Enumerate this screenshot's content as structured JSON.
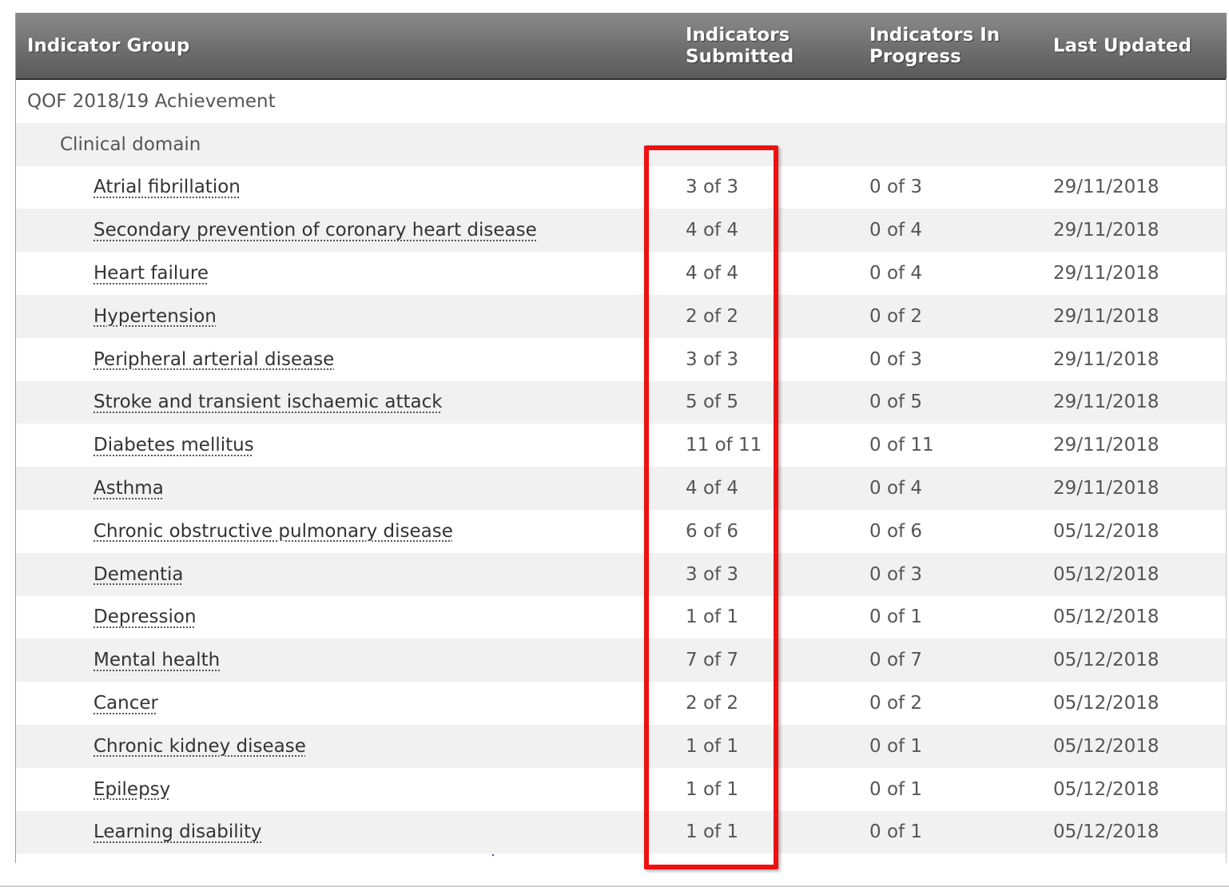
{
  "header": {
    "group": "Indicator Group",
    "submitted": "Indicators Submitted",
    "in_progress": "Indicators In Progress",
    "last_updated": "Last Updated"
  },
  "group_title": "QOF 2018/19 Achievement",
  "domain": "Clinical domain",
  "rows": [
    {
      "name": "Atrial fibrillation",
      "submitted": "3 of 3",
      "in_progress": "0 of 3",
      "updated": "29/11/2018"
    },
    {
      "name": "Secondary prevention of coronary heart disease",
      "submitted": "4 of 4",
      "in_progress": "0 of 4",
      "updated": "29/11/2018"
    },
    {
      "name": "Heart failure",
      "submitted": "4 of 4",
      "in_progress": "0 of 4",
      "updated": "29/11/2018"
    },
    {
      "name": "Hypertension",
      "submitted": "2 of 2",
      "in_progress": "0 of 2",
      "updated": "29/11/2018"
    },
    {
      "name": "Peripheral arterial disease",
      "submitted": "3 of 3",
      "in_progress": "0 of 3",
      "updated": "29/11/2018"
    },
    {
      "name": "Stroke and transient ischaemic attack",
      "submitted": "5 of 5",
      "in_progress": "0 of 5",
      "updated": "29/11/2018"
    },
    {
      "name": "Diabetes mellitus",
      "submitted": "11 of 11",
      "in_progress": "0 of 11",
      "updated": "29/11/2018"
    },
    {
      "name": "Asthma",
      "submitted": "4 of 4",
      "in_progress": "0 of 4",
      "updated": "29/11/2018"
    },
    {
      "name": "Chronic obstructive pulmonary disease",
      "submitted": "6 of 6",
      "in_progress": "0 of 6",
      "updated": "05/12/2018"
    },
    {
      "name": "Dementia",
      "submitted": "3 of 3",
      "in_progress": "0 of 3",
      "updated": "05/12/2018"
    },
    {
      "name": "Depression",
      "submitted": "1 of 1",
      "in_progress": "0 of 1",
      "updated": "05/12/2018"
    },
    {
      "name": "Mental health",
      "submitted": "7 of 7",
      "in_progress": "0 of 7",
      "updated": "05/12/2018"
    },
    {
      "name": "Cancer",
      "submitted": "2 of 2",
      "in_progress": "0 of 2",
      "updated": "05/12/2018"
    },
    {
      "name": "Chronic kidney disease",
      "submitted": "1 of 1",
      "in_progress": "0 of 1",
      "updated": "05/12/2018"
    },
    {
      "name": "Epilepsy",
      "submitted": "1 of 1",
      "in_progress": "0 of 1",
      "updated": "05/12/2018"
    },
    {
      "name": "Learning disability",
      "submitted": "1 of 1",
      "in_progress": "0 of 1",
      "updated": "05/12/2018"
    }
  ],
  "colors": {
    "highlight": "#ee1111",
    "header_bg": "#6e6e6e",
    "row_alt": "#f1f1f1"
  }
}
